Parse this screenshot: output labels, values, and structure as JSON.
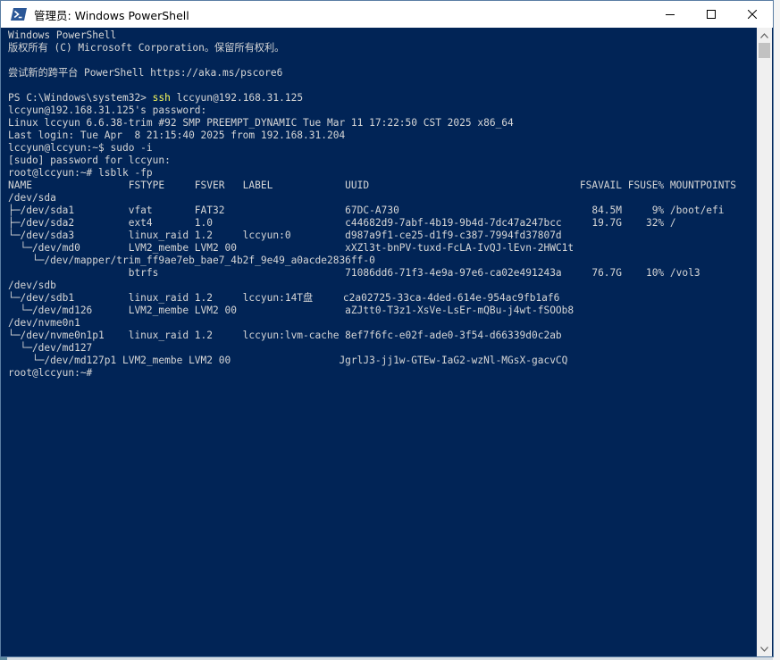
{
  "window": {
    "title": "管理员: Windows PowerShell",
    "app_icon": "powershell-icon",
    "controls": [
      "minimize-icon",
      "maximize-icon",
      "close-icon"
    ]
  },
  "colors": {
    "terminal_bg": "#012456",
    "text": "#d6d6d6",
    "command": "#fcfc5a"
  },
  "terminal": {
    "lines": [
      {
        "text": "Windows PowerShell"
      },
      {
        "text": "版权所有 (C) Microsoft Corporation。保留所有权利。"
      },
      {
        "text": ""
      },
      {
        "text": "尝试新的跨平台 PowerShell https://aka.ms/pscore6"
      },
      {
        "text": ""
      },
      {
        "prefix": "PS C:\\Windows\\system32> ",
        "cmd": "ssh",
        "suffix": " lccyun@192.168.31.125"
      },
      {
        "text": "lccyun@192.168.31.125's password:"
      },
      {
        "text": "Linux lccyun 6.6.38-trim #92 SMP PREEMPT_DYNAMIC Tue Mar 11 17:22:50 CST 2025 x86_64"
      },
      {
        "text": "Last login: Tue Apr  8 21:15:40 2025 from 192.168.31.204"
      },
      {
        "text": "lccyun@lccyun:~$ sudo -i"
      },
      {
        "text": "[sudo] password for lccyun:"
      },
      {
        "text": "root@lccyun:~# lsblk -fp"
      },
      {
        "text": "NAME                FSTYPE     FSVER   LABEL            UUID                                   FSAVAIL FSUSE% MOUNTPOINTS"
      },
      {
        "text": "/dev/sda"
      },
      {
        "text": "├─/dev/sda1         vfat       FAT32                    67DC-A730                                84.5M     9% /boot/efi"
      },
      {
        "text": "├─/dev/sda2         ext4       1.0                      c44682d9-7abf-4b19-9b4d-7dc47a247bcc     19.7G    32% /"
      },
      {
        "text": "└─/dev/sda3         linux_raid 1.2     lccyun:0         d987a9f1-ce25-d1f9-c387-7994fd37807d"
      },
      {
        "text": "  └─/dev/md0        LVM2_membe LVM2 00                  xXZl3t-bnPV-tuxd-FcLA-IvQJ-lEvn-2HWC1t"
      },
      {
        "text": "    └─/dev/mapper/trim_ff9ae7eb_bae7_4b2f_9e49_a0acde2836ff-0"
      },
      {
        "text": "                    btrfs                               71086dd6-71f3-4e9a-97e6-ca02e491243a     76.7G    10% /vol3"
      },
      {
        "text": "/dev/sdb"
      },
      {
        "text": "└─/dev/sdb1         linux_raid 1.2     lccyun:14T盘     c2a02725-33ca-4ded-614e-954ac9fb1af6"
      },
      {
        "text": "  └─/dev/md126      LVM2_membe LVM2 00                  aZJtt0-T3z1-XsVe-LsEr-mQBu-j4wt-fSOOb8"
      },
      {
        "text": "/dev/nvme0n1"
      },
      {
        "text": "└─/dev/nvme0n1p1    linux_raid 1.2     lccyun:lvm-cache 8ef7f6fc-e02f-ade0-3f54-d66339d0c2ab"
      },
      {
        "text": "  └─/dev/md127"
      },
      {
        "text": "    └─/dev/md127p1 LVM2_membe LVM2 00                  JgrlJ3-jj1w-GTEw-IaG2-wzNl-MGsX-gacvCQ"
      },
      {
        "text": "root@lccyun:~#"
      }
    ]
  }
}
